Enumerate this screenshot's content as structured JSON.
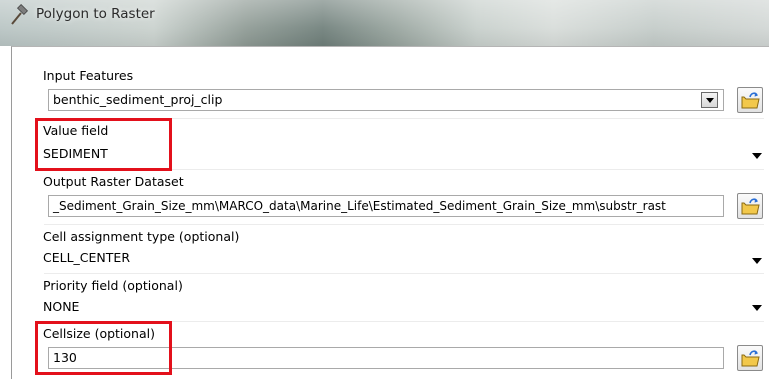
{
  "window": {
    "title": "Polygon to Raster",
    "icon": "hammer-icon"
  },
  "fields": {
    "input_features": {
      "label": "Input Features",
      "value": "benthic_sediment_proj_clip",
      "control": "combo-box",
      "browse_icon": "open-folder-icon"
    },
    "value_field": {
      "label": "Value field",
      "value": "SEDIMENT",
      "control": "dropdown"
    },
    "output_raster": {
      "label": "Output Raster Dataset",
      "value": "_Sediment_Grain_Size_mm\\MARCO_data\\Marine_Life\\Estimated_Sediment_Grain_Size_mm\\substr_rast",
      "browse_icon": "open-folder-icon"
    },
    "cell_assignment": {
      "label": "Cell assignment type (optional)",
      "value": "CELL_CENTER",
      "control": "dropdown"
    },
    "priority_field": {
      "label": "Priority field (optional)",
      "value": "NONE",
      "control": "dropdown"
    },
    "cellsize": {
      "label": "Cellsize (optional)",
      "value": "130",
      "browse_icon": "open-folder-icon"
    }
  },
  "annotations": {
    "highlight_color": "#e3101b",
    "highlighted": [
      "value_field",
      "cellsize"
    ]
  },
  "colors": {
    "folder_yellow": "#f2c84b",
    "folder_blue_arrow": "#2a6fd6"
  }
}
